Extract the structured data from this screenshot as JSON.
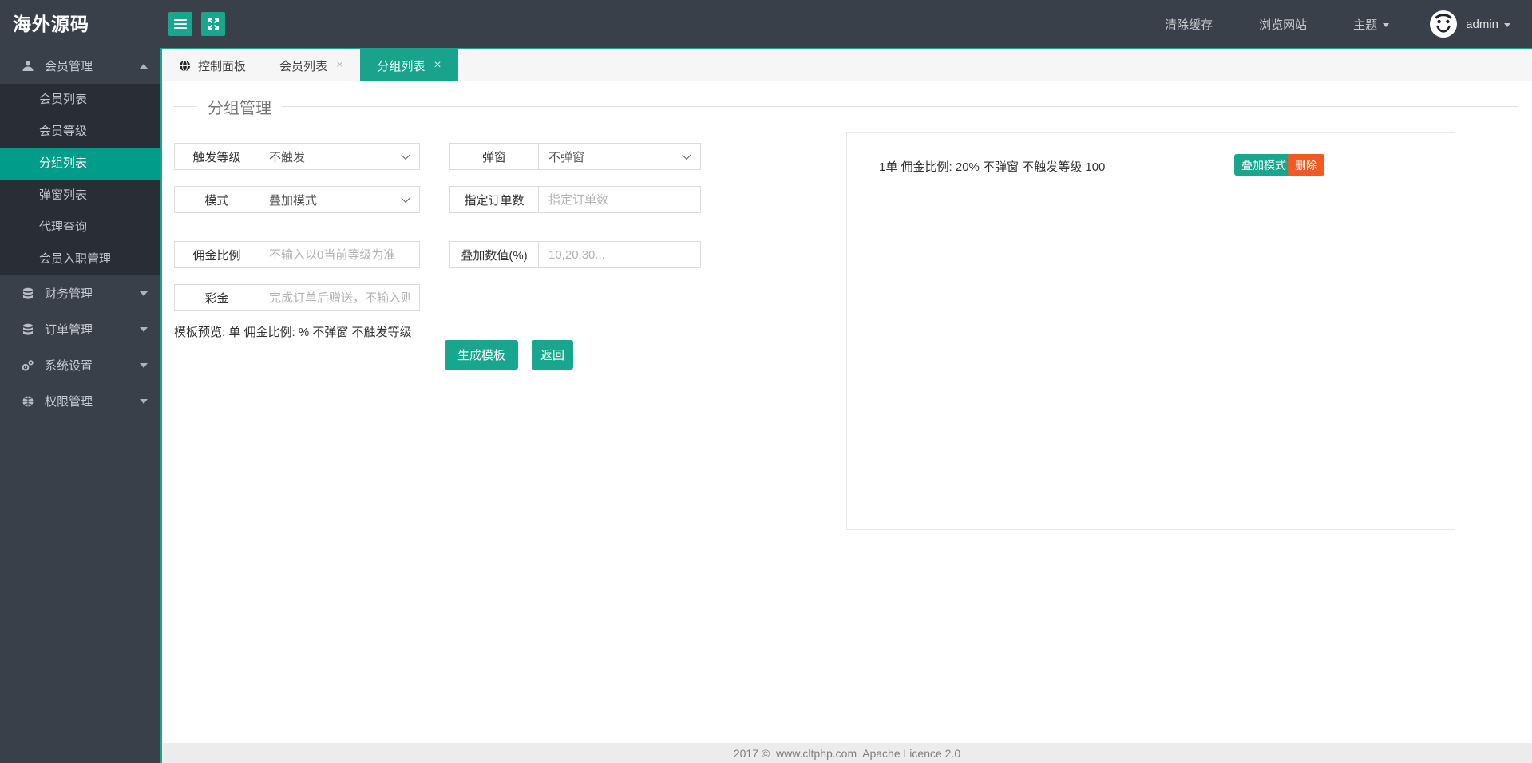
{
  "logo": "海外源码",
  "colors": {
    "accent": "#18a78e",
    "sidebar_active": "#029c8b",
    "delete": "#f15a24",
    "sidebar_bg": "#394049",
    "submenu_bg": "#282d36"
  },
  "glyphs": {
    "close": "×"
  },
  "icons": {
    "menu": "hamburger-icon",
    "fullscreen": "expand-icon",
    "member": "user-icon",
    "finance": "database-icon",
    "order": "database-icon",
    "system": "cogs-icon",
    "permission": "globe-grid-icon",
    "dashboard_tab": "globe-icon",
    "avatar": "smiley-avatar"
  },
  "topbar": {
    "clear_cache": "清除缓存",
    "browse_site": "浏览网站",
    "theme": "主题",
    "username": "admin"
  },
  "sidebar": {
    "member": {
      "label": "会员管理",
      "children": [
        "会员列表",
        "会员等级",
        "分组列表",
        "弹窗列表",
        "代理查询",
        "会员入职管理"
      ],
      "active": "分组列表"
    },
    "others": [
      {
        "label": "财务管理"
      },
      {
        "label": "订单管理"
      },
      {
        "label": "系统设置"
      },
      {
        "label": "权限管理"
      }
    ]
  },
  "tabs": [
    {
      "label": "控制面板"
    },
    {
      "label": "会员列表"
    },
    {
      "label": "分组列表"
    }
  ],
  "page": {
    "heading": "分组管理",
    "form": {
      "trigger_level": {
        "label": "触发等级",
        "value": "不触发"
      },
      "popup": {
        "label": "弹窗",
        "value": "不弹窗"
      },
      "mode": {
        "label": "模式",
        "value": "叠加模式"
      },
      "order_count": {
        "label": "指定订单数",
        "placeholder": "指定订单数"
      },
      "commission": {
        "label": "佣金比例",
        "placeholder": "不输入以0当前等级为准"
      },
      "stack_value": {
        "label": "叠加数值(%)",
        "placeholder": "10,20,30..."
      },
      "bonus": {
        "label": "彩金",
        "placeholder": "完成订单后赠送，不输入则没有"
      },
      "preview": "模板预览: 单 佣金比例: % 不弹窗 不触发等级",
      "generate_label": "生成模板",
      "back_label": "返回"
    },
    "templates": [
      {
        "text": "1单 佣金比例: 20% 不弹窗 不触发等级 100",
        "mode_label": "叠加模式",
        "delete_label": "删除"
      }
    ]
  },
  "footer": "2017 ©  www.cltphp.com  Apache Licence 2.0"
}
